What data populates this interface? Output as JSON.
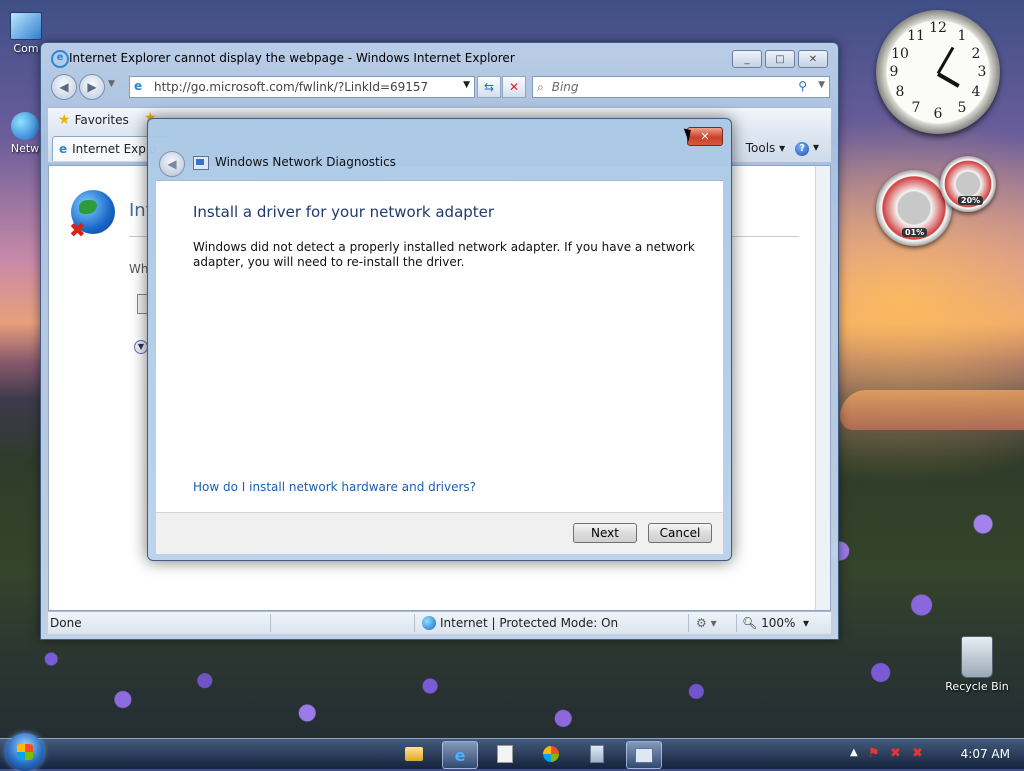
{
  "desktop": {
    "icons": [
      {
        "label": "Com"
      },
      {
        "label": "Netw"
      },
      {
        "label": "Recycle Bin"
      }
    ],
    "gadgets": {
      "clock_numbers": [
        "12",
        "1",
        "2",
        "3",
        "4",
        "5",
        "6",
        "7",
        "8",
        "9",
        "10",
        "11"
      ],
      "cpu_percent": "01%",
      "memory_percent": "20%"
    }
  },
  "ie": {
    "title": "Internet Explorer cannot display the webpage - Windows Internet Explorer",
    "address": "http://go.microsoft.com/fwlink/?LinkId=69157",
    "address_domain": "microsoft.com",
    "search_placeholder": "Bing",
    "favorites_label": "Favorites",
    "tab_label": "Internet Explo",
    "tools_label": "Tools",
    "page_heading": "Int",
    "page_text": "Wh",
    "status_done": "Done",
    "status_zone": "Internet | Protected Mode: On",
    "zoom": "100%"
  },
  "dialog": {
    "title": "Windows Network Diagnostics",
    "heading": "Install a driver for your network adapter",
    "message": "Windows did not detect a properly installed network adapter. If you have a network adapter, you will need to re-install the driver.",
    "link": "How do I install network hardware and drivers?",
    "next_label": "Next",
    "cancel_label": "Cancel"
  },
  "taskbar": {
    "time": "4:07 AM"
  },
  "colors": {
    "link": "#1a5fb4",
    "heading": "#1e3a6e",
    "close": "#c8412b"
  }
}
